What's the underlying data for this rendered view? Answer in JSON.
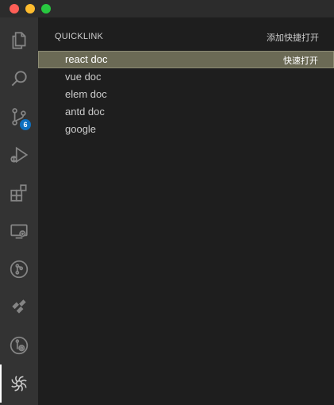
{
  "activity_bar": {
    "items": [
      {
        "icon": "explorer-icon"
      },
      {
        "icon": "search-icon"
      },
      {
        "icon": "source-control-icon",
        "badge": "6"
      },
      {
        "icon": "run-debug-icon"
      },
      {
        "icon": "extensions-icon"
      },
      {
        "icon": "remote-explorer-icon"
      },
      {
        "icon": "git-graph-icon"
      },
      {
        "icon": "jira-icon"
      },
      {
        "icon": "gitlens-icon"
      },
      {
        "icon": "quicklink-icon"
      }
    ]
  },
  "panel": {
    "title": "QUICKLINK",
    "add_action": "添加快捷打开",
    "items": [
      {
        "label": "react doc",
        "action": "快速打开"
      },
      {
        "label": "vue doc"
      },
      {
        "label": "elem doc"
      },
      {
        "label": "antd doc"
      },
      {
        "label": "google"
      }
    ]
  },
  "colors": {
    "selection": "#6b6a55",
    "badge": "#0e70c0"
  }
}
